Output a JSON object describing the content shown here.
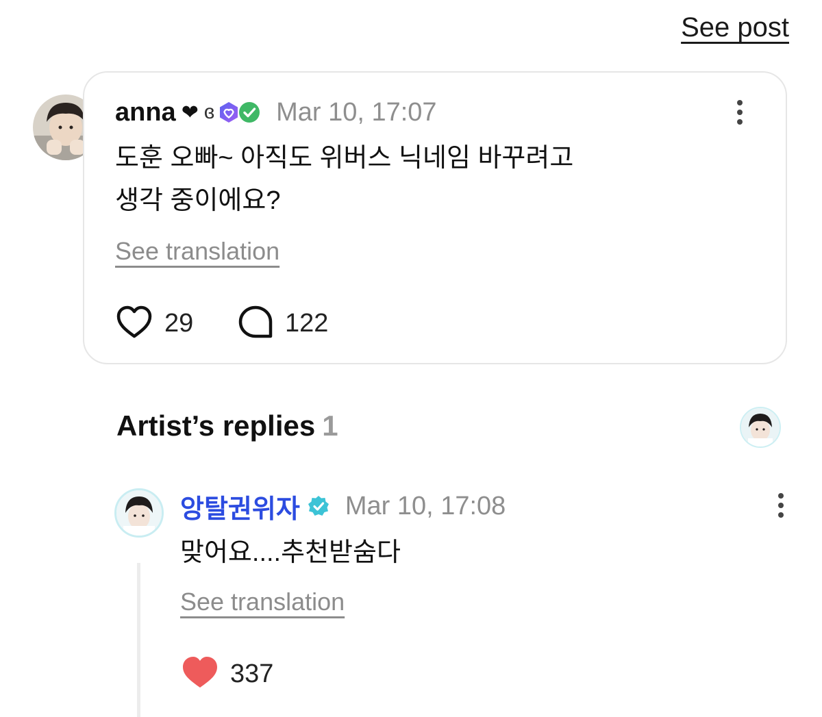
{
  "top_link": {
    "label": "See post"
  },
  "post": {
    "author": "anna",
    "heart_emoji": "❤",
    "ascii_deco": "ɞ",
    "timestamp": "Mar 10, 17:07",
    "text_line1": "도훈 오빠~ 아직도 위버스 닉네임 바꾸려고",
    "text_line2": "생각 중이에요?",
    "translate_label": "See translation",
    "likes": "29",
    "comments": "122",
    "icons": [
      "heart-outline-icon",
      "comment-bubble-icon",
      "more-vertical-icon",
      "membership-badge-icon",
      "verified-check-badge-icon"
    ]
  },
  "artist_replies": {
    "title": "Artist’s replies",
    "count": "1"
  },
  "reply": {
    "author": "앙탈권위자",
    "timestamp": "Mar 10, 17:08",
    "text": "맞어요....추천받숨다",
    "translate_label": "See translation",
    "likes": "337",
    "icons": [
      "verified-badge-icon",
      "heart-filled-icon",
      "more-vertical-icon"
    ]
  },
  "colors": {
    "artist_name": "#2c4ce0",
    "verified_badge": "#3cc3d6",
    "liked_heart": "#ee5b5b",
    "card_border": "#e6e6e6",
    "muted_text": "#8e8e8e"
  }
}
